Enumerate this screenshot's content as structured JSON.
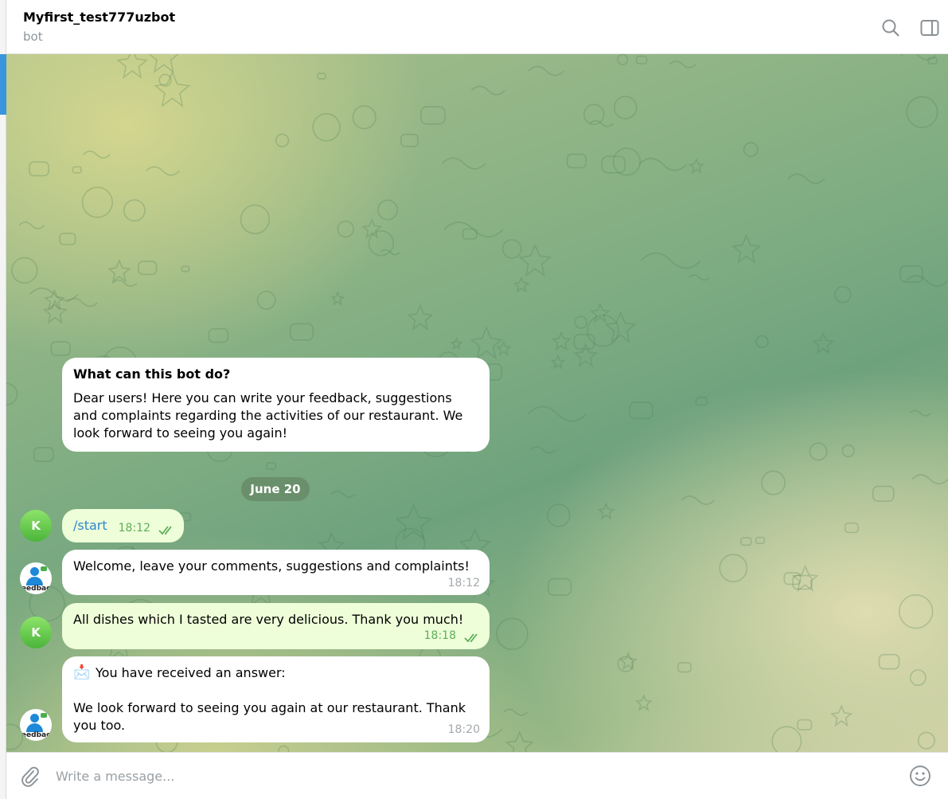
{
  "header": {
    "title": "Myfirst_test777uzbot",
    "subtitle": "bot",
    "search_icon": "search-icon",
    "panel_icon": "side-panel-icon"
  },
  "intro": {
    "title": "What can this bot do?",
    "body": "Dear users! Here you can write your feedback, suggestions and complaints regarding the activities of our restaurant. We look forward to seeing you again!"
  },
  "date_separator": "June 20",
  "messages": [
    {
      "sender": "user",
      "avatar_letter": "K",
      "text": "/start",
      "time": "18:12",
      "status": "read"
    },
    {
      "sender": "bot",
      "avatar_text": "feedback",
      "text": "Welcome, leave your comments, suggestions and complaints!",
      "time": "18:12"
    },
    {
      "sender": "user",
      "avatar_letter": "K",
      "text": "All dishes which I tasted are very delicious. Thank you much!",
      "time": "18:18",
      "status": "read"
    },
    {
      "sender": "bot",
      "avatar_text": "feedback",
      "emoji": "📩",
      "text": "You have received an answer:",
      "text2": "We look forward to seeing you again at our restaurant. Thank you too.",
      "time": "18:20"
    }
  ],
  "composer": {
    "placeholder": "Write a message...",
    "attach_icon": "paperclip-icon",
    "emoji_icon": "smiley-icon"
  },
  "colors": {
    "accent": "#3a95dd",
    "command_link": "#2f88c9",
    "outgoing_bubble": "#eefed9",
    "outgoing_time": "#5dae58",
    "date_pill": "#6a8f6b"
  }
}
